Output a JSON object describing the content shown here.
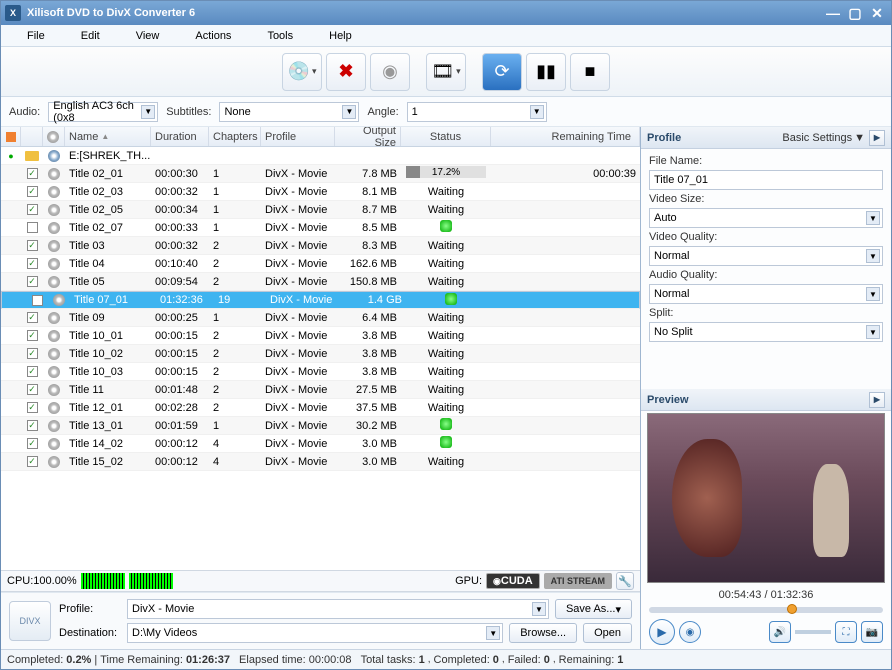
{
  "window": {
    "title": "Xilisoft DVD to DivX Converter 6"
  },
  "menu": [
    "File",
    "Edit",
    "View",
    "Actions",
    "Tools",
    "Help"
  ],
  "filters": {
    "audio_label": "Audio:",
    "audio_value": "English AC3 6ch (0x8",
    "subtitles_label": "Subtitles:",
    "subtitles_value": "None",
    "angle_label": "Angle:",
    "angle_value": "1"
  },
  "columns": [
    "",
    "",
    "",
    "Name",
    "Duration",
    "Chapters",
    "Profile",
    "Output Size",
    "Status",
    "Remaining Time"
  ],
  "disc_row": {
    "name": "E:[SHREK_TH..."
  },
  "rows": [
    {
      "chk": true,
      "name": "Title 02_01",
      "dur": "00:00:30",
      "ch": "1",
      "prof": "DivX - Movie",
      "size": "7.8 MB",
      "status": "progress",
      "pct": "17.2%",
      "rem": "00:00:39"
    },
    {
      "chk": true,
      "name": "Title 02_03",
      "dur": "00:00:32",
      "ch": "1",
      "prof": "DivX - Movie",
      "size": "8.1 MB",
      "status": "Waiting",
      "rem": ""
    },
    {
      "chk": true,
      "name": "Title 02_05",
      "dur": "00:00:34",
      "ch": "1",
      "prof": "DivX - Movie",
      "size": "8.7 MB",
      "status": "Waiting",
      "rem": ""
    },
    {
      "chk": false,
      "name": "Title 02_07",
      "dur": "00:00:33",
      "ch": "1",
      "prof": "DivX - Movie",
      "size": "8.5 MB",
      "status": "led",
      "rem": ""
    },
    {
      "chk": true,
      "name": "Title 03",
      "dur": "00:00:32",
      "ch": "2",
      "prof": "DivX - Movie",
      "size": "8.3 MB",
      "status": "Waiting",
      "rem": ""
    },
    {
      "chk": true,
      "name": "Title 04",
      "dur": "00:10:40",
      "ch": "2",
      "prof": "DivX - Movie",
      "size": "162.6 MB",
      "status": "Waiting",
      "rem": ""
    },
    {
      "chk": true,
      "name": "Title 05",
      "dur": "00:09:54",
      "ch": "2",
      "prof": "DivX - Movie",
      "size": "150.8 MB",
      "status": "Waiting",
      "rem": ""
    },
    {
      "chk": false,
      "name": "Title 07_01",
      "dur": "01:32:36",
      "ch": "19",
      "prof": "DivX - Movie",
      "size": "1.4 GB",
      "status": "led",
      "rem": "",
      "selected": true
    },
    {
      "chk": true,
      "name": "Title 09",
      "dur": "00:00:25",
      "ch": "1",
      "prof": "DivX - Movie",
      "size": "6.4 MB",
      "status": "Waiting",
      "rem": ""
    },
    {
      "chk": true,
      "name": "Title 10_01",
      "dur": "00:00:15",
      "ch": "2",
      "prof": "DivX - Movie",
      "size": "3.8 MB",
      "status": "Waiting",
      "rem": ""
    },
    {
      "chk": true,
      "name": "Title 10_02",
      "dur": "00:00:15",
      "ch": "2",
      "prof": "DivX - Movie",
      "size": "3.8 MB",
      "status": "Waiting",
      "rem": ""
    },
    {
      "chk": true,
      "name": "Title 10_03",
      "dur": "00:00:15",
      "ch": "2",
      "prof": "DivX - Movie",
      "size": "3.8 MB",
      "status": "Waiting",
      "rem": ""
    },
    {
      "chk": true,
      "name": "Title 11",
      "dur": "00:01:48",
      "ch": "2",
      "prof": "DivX - Movie",
      "size": "27.5 MB",
      "status": "Waiting",
      "rem": ""
    },
    {
      "chk": true,
      "name": "Title 12_01",
      "dur": "00:02:28",
      "ch": "2",
      "prof": "DivX - Movie",
      "size": "37.5 MB",
      "status": "Waiting",
      "rem": ""
    },
    {
      "chk": true,
      "name": "Title 13_01",
      "dur": "00:01:59",
      "ch": "1",
      "prof": "DivX - Movie",
      "size": "30.2 MB",
      "status": "led",
      "rem": ""
    },
    {
      "chk": true,
      "name": "Title 14_02",
      "dur": "00:00:12",
      "ch": "4",
      "prof": "DivX - Movie",
      "size": "3.0 MB",
      "status": "led",
      "rem": ""
    },
    {
      "chk": true,
      "name": "Title 15_02",
      "dur": "00:00:12",
      "ch": "4",
      "prof": "DivX - Movie",
      "size": "3.0 MB",
      "status": "Waiting",
      "rem": ""
    }
  ],
  "cpu": {
    "label": "CPU:100.00%",
    "gpu_label": "GPU:",
    "cuda": "CUDA",
    "ati": "ATI STREAM"
  },
  "bottom": {
    "profile_label": "Profile:",
    "profile_value": "DivX - Movie",
    "saveas": "Save As...",
    "dest_label": "Destination:",
    "dest_value": "D:\\My Videos",
    "browse": "Browse...",
    "open": "Open"
  },
  "profile_panel": {
    "title": "Profile",
    "mode": "Basic Settings",
    "fn_label": "File Name:",
    "fn_value": "Title 07_01",
    "vs_label": "Video Size:",
    "vs_value": "Auto",
    "vq_label": "Video Quality:",
    "vq_value": "Normal",
    "aq_label": "Audio Quality:",
    "aq_value": "Normal",
    "sp_label": "Split:",
    "sp_value": "No Split"
  },
  "preview": {
    "title": "Preview",
    "time": "00:54:43 / 01:32:36",
    "pos": 0.59
  },
  "status": {
    "completed_label": "Completed:",
    "completed": "0.2%",
    "sep": " | ",
    "tr_label": "Time Remaining:",
    "tr": "01:26:37",
    "et_label": "Elapsed time:",
    "et": "00:00:08",
    "tt_label": "Total tasks:",
    "tt": "1",
    "cp_label": "Completed:",
    "cp": "0",
    "fl_label": "Failed:",
    "fl": "0",
    "rm_label": "Remaining:",
    "rm": "1"
  }
}
